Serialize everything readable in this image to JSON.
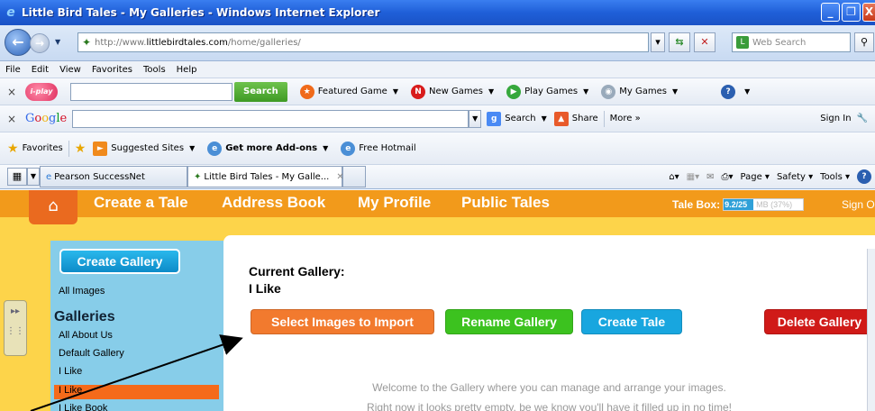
{
  "window": {
    "title": "Little Bird Tales - My Galleries - Windows Internet Explorer",
    "min": "_",
    "max": "❐",
    "close": "X"
  },
  "address": {
    "url_prefix": "http://www.",
    "url_host": "littlebirdtales.com",
    "url_path": "/home/galleries/",
    "search_placeholder": "Web Search"
  },
  "menu": [
    "File",
    "Edit",
    "View",
    "Favorites",
    "Tools",
    "Help"
  ],
  "toolbar_iplay": {
    "logo": "i-play",
    "search_label": "Search",
    "items": [
      "Featured Game",
      "New Games",
      "Play Games",
      "My Games"
    ]
  },
  "toolbar_google": {
    "logo": "Google",
    "search_label": "Search",
    "share_label": "Share",
    "more_label": "More »",
    "signin_label": "Sign In"
  },
  "favorites_bar": {
    "favorites_label": "Favorites",
    "items": [
      "Suggested Sites",
      "Get more Add-ons",
      "Free Hotmail"
    ]
  },
  "tabs": [
    "Pearson SuccessNet",
    "Little Bird Tales - My Galle..."
  ],
  "command_bar": [
    "Page",
    "Safety",
    "Tools"
  ],
  "site_nav": {
    "links": [
      "Create a Tale",
      "Address Book",
      "My Profile",
      "Public Tales"
    ],
    "tale_box_label": "Tale Box:",
    "tale_box_used": "9.2/25",
    "tale_box_pct": "MB (37%)",
    "tale_box_fraction": 0.37,
    "sign_out": "Sign O"
  },
  "sidebar": {
    "create_gallery": "Create Gallery",
    "all_images": "All Images",
    "galleries_heading": "Galleries",
    "galleries": [
      "All About Us",
      "Default Gallery",
      "I Like",
      "I Like",
      "I Like Book"
    ]
  },
  "gallery": {
    "current_label": "Current Gallery:",
    "name": "I Like",
    "buttons": {
      "select_images": "Select Images to Import",
      "rename": "Rename Gallery",
      "create_tale": "Create Tale",
      "delete": "Delete Gallery"
    },
    "welcome_line1": "Welcome to the Gallery where you can manage and arrange your images.",
    "welcome_line2": "Right now it looks pretty empty, be we know you'll have it filled up in no time!"
  },
  "colors": {
    "orange_button": "#f27a2e",
    "green_button": "#3cc21f",
    "blue_button": "#18a6df",
    "red_button": "#d01a18",
    "site_orange": "#f29a1b",
    "site_yellow": "#fdd44a",
    "sidebar_blue": "#87cde9"
  }
}
